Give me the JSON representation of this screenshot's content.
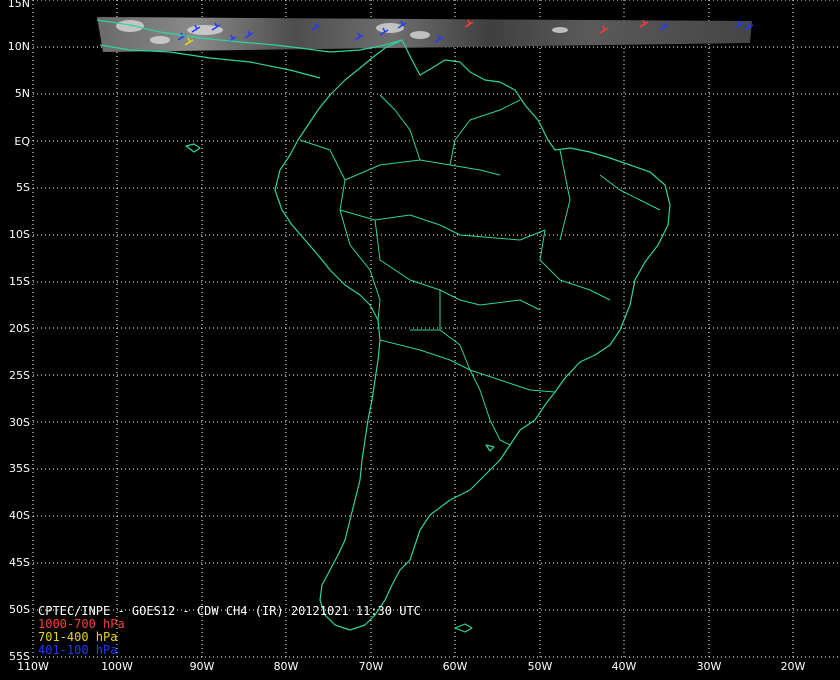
{
  "map": {
    "title": "CPTEC/INPE - GOES12 - CDW CH4 (IR) 20121021 11:30 UTC",
    "legend": [
      {
        "label": "1000-700 hPa",
        "color": "#ff3b3b"
      },
      {
        "label": "701-400 hPa",
        "color": "#e8d21c"
      },
      {
        "label": "401-100 hPa",
        "color": "#1f3bff"
      }
    ],
    "colors": {
      "coastline": "#2ed3a0",
      "grid": "#ffffff",
      "background": "#000000"
    },
    "lat_labels": [
      "15N",
      "10N",
      "5N",
      "EQ",
      "5S",
      "10S",
      "15S",
      "20S",
      "25S",
      "30S",
      "35S",
      "40S",
      "45S",
      "50S",
      "55S"
    ],
    "lon_labels": [
      "110W",
      "100W",
      "90W",
      "80W",
      "70W",
      "60W",
      "50W",
      "40W",
      "30W",
      "20W"
    ]
  }
}
